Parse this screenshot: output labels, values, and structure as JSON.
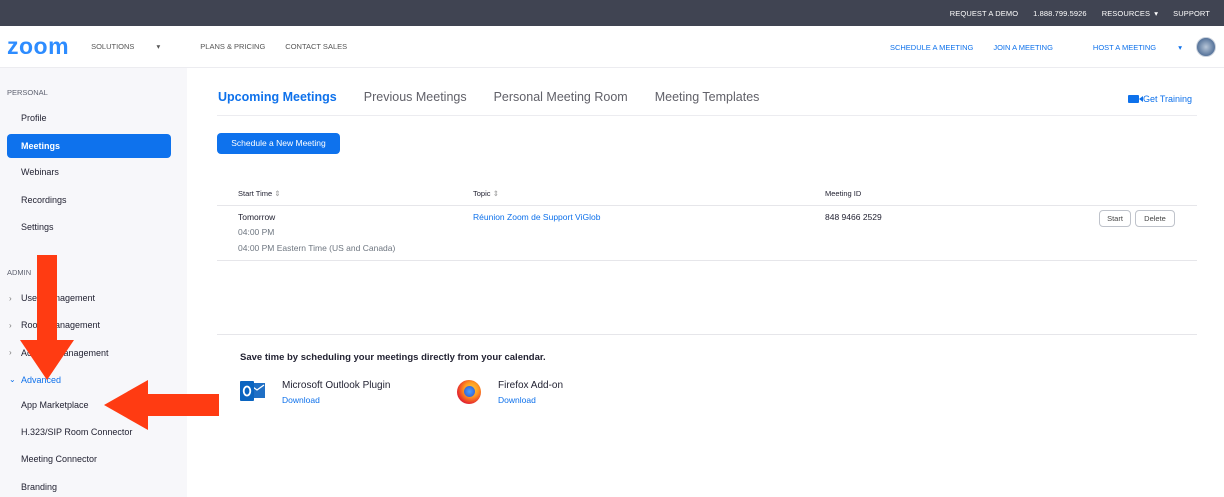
{
  "topbar": {
    "request_demo": "REQUEST A DEMO",
    "phone": "1.888.799.5926",
    "resources": "RESOURCES",
    "support": "SUPPORT"
  },
  "navbar": {
    "logo": "zoom",
    "solutions": "SOLUTIONS",
    "plans": "PLANS & PRICING",
    "contact": "CONTACT SALES",
    "schedule": "SCHEDULE A MEETING",
    "join": "JOIN A MEETING",
    "host": "HOST A MEETING"
  },
  "sidebar": {
    "personal_label": "PERSONAL",
    "personal_items": [
      "Profile",
      "Meetings",
      "Webinars",
      "Recordings",
      "Settings"
    ],
    "admin_label": "ADMIN",
    "admin_items": [
      "User Management",
      "Room Management",
      "Account Management",
      "Advanced"
    ],
    "advanced_items": [
      "App Marketplace",
      "H.323/SIP Room Connector",
      "Meeting Connector",
      "Branding"
    ]
  },
  "tabs": [
    "Upcoming Meetings",
    "Previous Meetings",
    "Personal Meeting Room",
    "Meeting Templates"
  ],
  "get_training": "Get Training",
  "schedule_button": "Schedule a New Meeting",
  "table": {
    "headers": [
      "Start Time",
      "Topic",
      "Meeting ID"
    ],
    "rows": [
      {
        "day": "Tomorrow",
        "time": "04:00 PM",
        "timezone": "04:00 PM Eastern Time (US and Canada)",
        "topic": "Réunion Zoom de Support ViGlob",
        "meeting_id": "848 9466 2529",
        "start_label": "Start",
        "delete_label": "Delete"
      }
    ]
  },
  "promo": {
    "title": "Save time by scheduling your meetings directly from your calendar.",
    "plugins": [
      {
        "name": "Microsoft Outlook Plugin",
        "action": "Download",
        "icon": "outlook-icon"
      },
      {
        "name": "Firefox Add-on",
        "action": "Download",
        "icon": "firefox-icon"
      }
    ]
  },
  "colors": {
    "accent": "#0E72ED",
    "topbar": "#404452",
    "annotation_arrow": "#FF3B12"
  }
}
